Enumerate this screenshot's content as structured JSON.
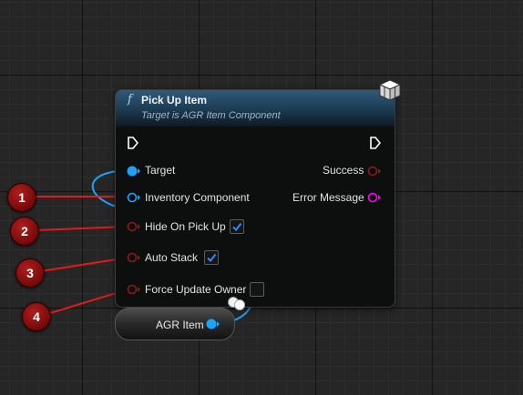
{
  "node": {
    "title": "Pick Up Item",
    "subtitle": "Target is AGR Item Component",
    "title_icon": "function-icon",
    "title_glyph": "f",
    "target_icon": "component-cube-icon",
    "header_color": "#2f5a7a"
  },
  "pins": {
    "exec_in": "exec-input-pin",
    "exec_out": "exec-output-pin",
    "target": "Target",
    "inventory_component": "Inventory Component",
    "hide_on_pick_up": "Hide On Pick Up",
    "auto_stack": "Auto Stack",
    "force_update_owner": "Force Update Owner",
    "success": "Success",
    "error_message": "Error Message"
  },
  "checkboxes": {
    "hide_on_pick_up_checked": true,
    "auto_stack_checked": true,
    "force_update_owner_checked": false
  },
  "variable_node": {
    "label": "AGR Item"
  },
  "markers": [
    "1",
    "2",
    "3",
    "4"
  ],
  "colors": {
    "object_pin": "#1aa3ff",
    "bool_pin": "#8c1a1a",
    "string_pin": "#ff00ff",
    "exec_pin": "#ffffff",
    "arrow": "#e01b1b",
    "marker": "#9b1515"
  }
}
